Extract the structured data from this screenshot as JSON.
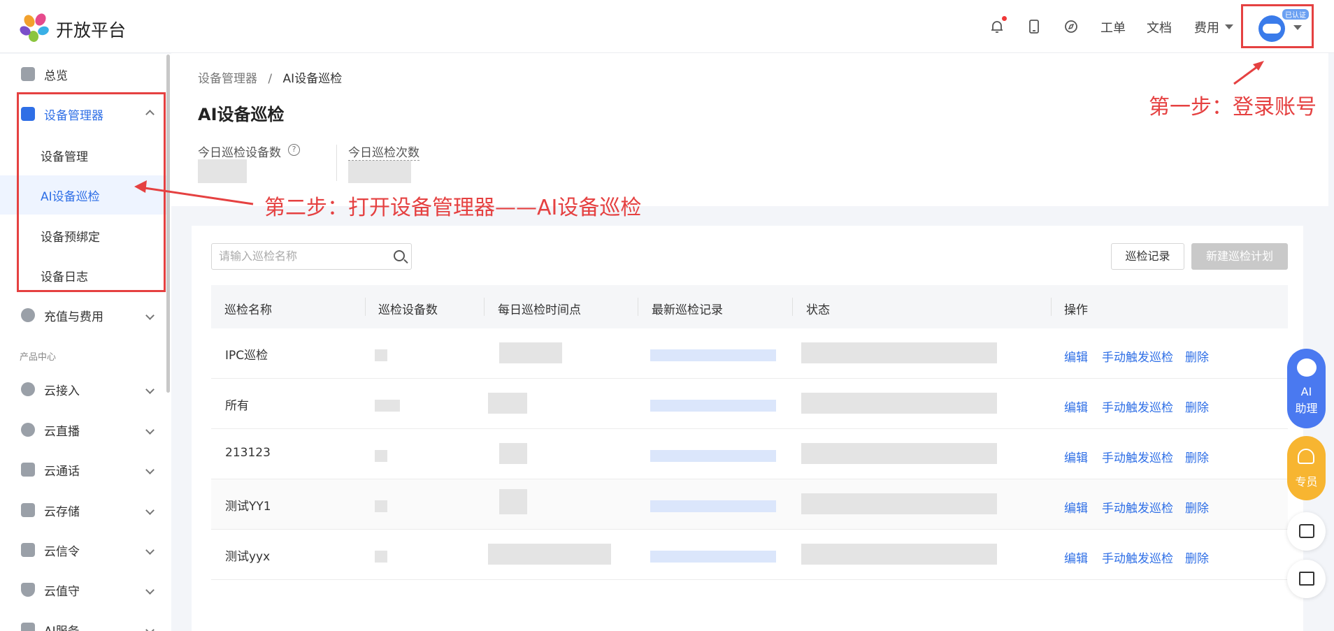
{
  "header": {
    "logo_text": "开放平台",
    "links": [
      "工单",
      "文档",
      "费用"
    ],
    "avatar_badge": "已认证",
    "icons": [
      "bell-icon",
      "tablet-icon",
      "compass-icon"
    ]
  },
  "sidebar": {
    "overview": "总览",
    "device_manager": "设备管理器",
    "sub_items": [
      "设备管理",
      "AI设备巡检",
      "设备预绑定",
      "设备日志"
    ],
    "recharge": "充值与费用",
    "section_title": "产品中心",
    "products": [
      "云接入",
      "云直播",
      "云通话",
      "云存储",
      "云信令",
      "云值守",
      "AI服务"
    ]
  },
  "breadcrumb": {
    "parent": "设备管理器",
    "sep": "/",
    "current": "AI设备巡检"
  },
  "page_title": "AI设备巡检",
  "stats": {
    "devices_label": "今日巡检设备数",
    "count_label": "今日巡检次数"
  },
  "toolbar": {
    "search_placeholder": "请输入巡检名称",
    "records_button": "巡检记录",
    "new_plan_button": "新建巡检计划"
  },
  "table": {
    "columns": [
      "巡检名称",
      "巡检设备数",
      "每日巡检时间点",
      "最新巡检记录",
      "状态",
      "操作"
    ],
    "rows": [
      {
        "name": "IPC巡检"
      },
      {
        "name": "所有"
      },
      {
        "name": "213123"
      },
      {
        "name": "测试YY1"
      },
      {
        "name": "测试yyx"
      }
    ],
    "actions": {
      "edit": "编辑",
      "trigger": "手动触发巡检",
      "delete": "删除"
    }
  },
  "float": {
    "ai_line1": "AI",
    "ai_line2": "助理",
    "vip": "专员"
  },
  "annotations": {
    "step1": "第一步：登录账号",
    "step2": "第二步：打开设备管理器——AI设备巡检"
  },
  "colors": {
    "accent": "#2f6fe6",
    "annotation": "#e54141",
    "disabled": "#c9c9c9"
  }
}
